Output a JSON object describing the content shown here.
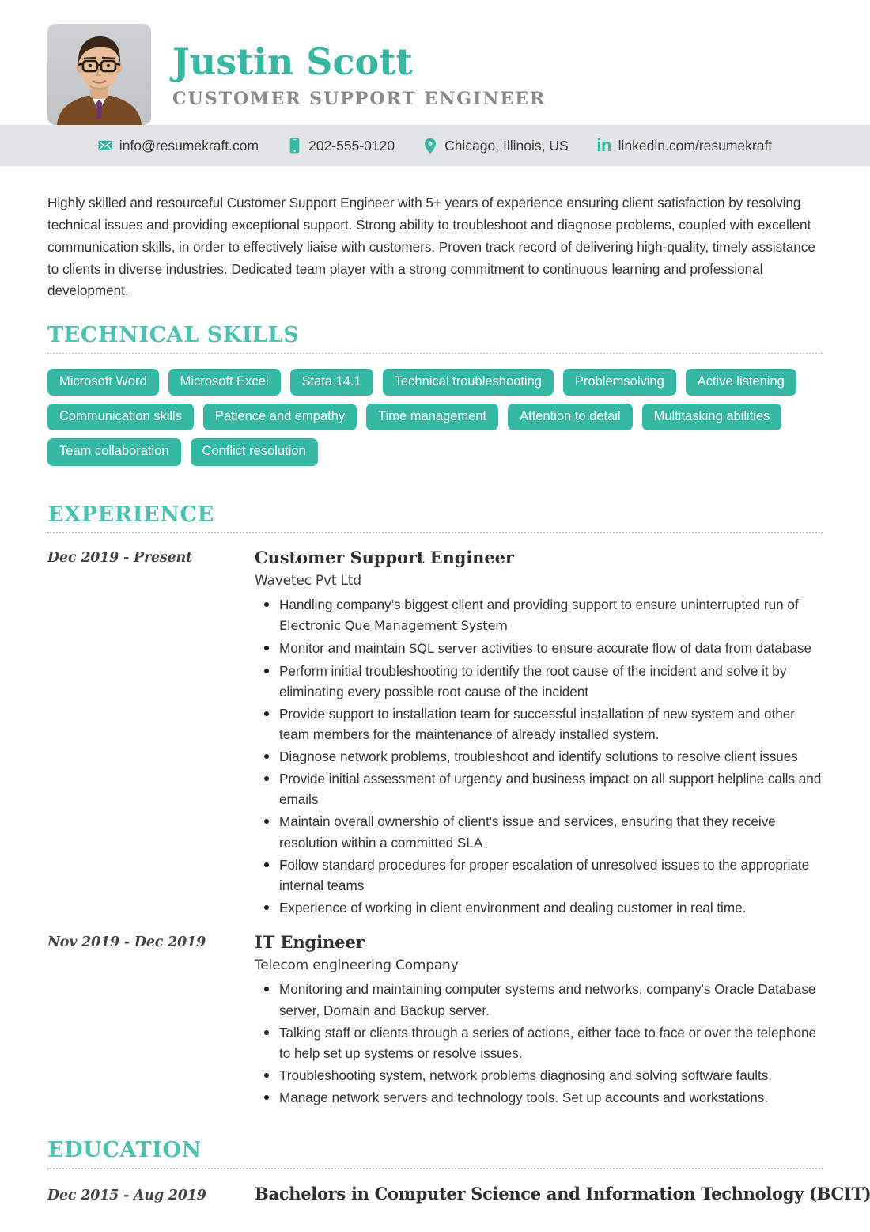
{
  "theme": {
    "accent": "#35b9a4",
    "heading_accent": "#4cc3b0",
    "contact_bar_bg": "#e3e4e6",
    "subtitle_gray": "#8a8a8a",
    "text": "#333333"
  },
  "header": {
    "name": "Justin Scott",
    "job_title": "CUSTOMER SUPPORT ENGINEER",
    "photo_alt": "profile-photo"
  },
  "contact": [
    {
      "icon": "envelope-icon",
      "label": "info@resumekraft.com"
    },
    {
      "icon": "phone-icon",
      "label": "202-555-0120"
    },
    {
      "icon": "location-pin-icon",
      "label": "Chicago, Illinois, US"
    },
    {
      "icon": "linkedin-icon",
      "label": "linkedin.com/resumekraft"
    }
  ],
  "summary": "Highly skilled and resourceful Customer Support Engineer with 5+ years of experience ensuring client satisfaction by resolving technical issues and providing exceptional support. Strong ability to troubleshoot and diagnose problems, coupled with excellent communication skills, in order to effectively liaise with customers. Proven track record of delivering high-quality, timely assistance to clients in diverse industries. Dedicated team player with a strong commitment to continuous learning and professional development.",
  "sections": {
    "skills_heading": "TECHNICAL SKILLS",
    "experience_heading": "EXPERIENCE",
    "education_heading": "EDUCATION"
  },
  "skills": [
    "Microsoft Word",
    "Microsoft Excel",
    "Stata 14.1",
    "Technical troubleshooting",
    "Problemsolving",
    "Active listening",
    "Communication skills",
    "Patience and empathy",
    "Time management",
    "Attention to detail",
    "Multitasking abilities",
    "Team collaboration",
    "Conflict resolution"
  ],
  "experience": [
    {
      "date": "Dec 2019 - Present",
      "title": "Customer Support Engineer",
      "company": "Wavetec Pvt Ltd",
      "company_styled": true,
      "bullets": [
        {
          "pre": "Handling company’s biggest client and providing support to ensure uninterrupted run of ",
          "hl": "Electronic Que Management System",
          "post": ""
        },
        {
          "pre": "Monitor and maintain ",
          "hl": "SQL server",
          "post": " activities to ensure accurate flow of data from database"
        },
        {
          "pre": "Perform initial troubleshooting to identify the root cause of the incident and solve it by eliminating every possible root cause of the incident",
          "hl": "",
          "post": ""
        },
        {
          "pre": "Provide support to installation team for successful installation of new system and other team members for the maintenance of already installed system.",
          "hl": "",
          "post": ""
        },
        {
          "pre": "Diagnose network problems, troubleshoot and identify solutions to resolve client issues",
          "hl": "",
          "post": ""
        },
        {
          "pre": "Provide initial assessment of urgency and business impact on all support helpline calls and emails",
          "hl": "",
          "post": ""
        },
        {
          "pre": "Maintain overall ownership of client's issue and services, ensuring that they receive resolution within a committed SLA",
          "hl": "",
          "post": ""
        },
        {
          "pre": "Follow standard procedures for proper escalation of unresolved issues to the appropriate internal teams",
          "hl": "",
          "post": ""
        },
        {
          "pre": "Experience of working in client environment and dealing customer in real time.",
          "hl": "",
          "post": ""
        }
      ]
    },
    {
      "date": "Nov 2019 - Dec 2019",
      "title": "IT Engineer",
      "company": "Telecom engineering Company",
      "company_styled": true,
      "bullets": [
        {
          "pre": "Monitoring and maintaining computer systems and networks, company's Oracle Database server, Domain and Backup server.",
          "hl": "",
          "post": ""
        },
        {
          "pre": "Talking staff or clients through a series of actions, either face to face or over the telephone to help set up systems or resolve issues.",
          "hl": "",
          "post": "",
          "justify": true
        },
        {
          "pre": "Troubleshooting system, network problems diagnosing and solving software faults.",
          "hl": "",
          "post": ""
        },
        {
          "pre": "Manage network servers and technology tools. Set up accounts and workstations.",
          "hl": "",
          "post": ""
        }
      ]
    }
  ],
  "education": [
    {
      "date": "Dec 2015 - Aug 2019",
      "degree": "Bachelors in Computer Science and Information Technology (BCIT)"
    }
  ]
}
